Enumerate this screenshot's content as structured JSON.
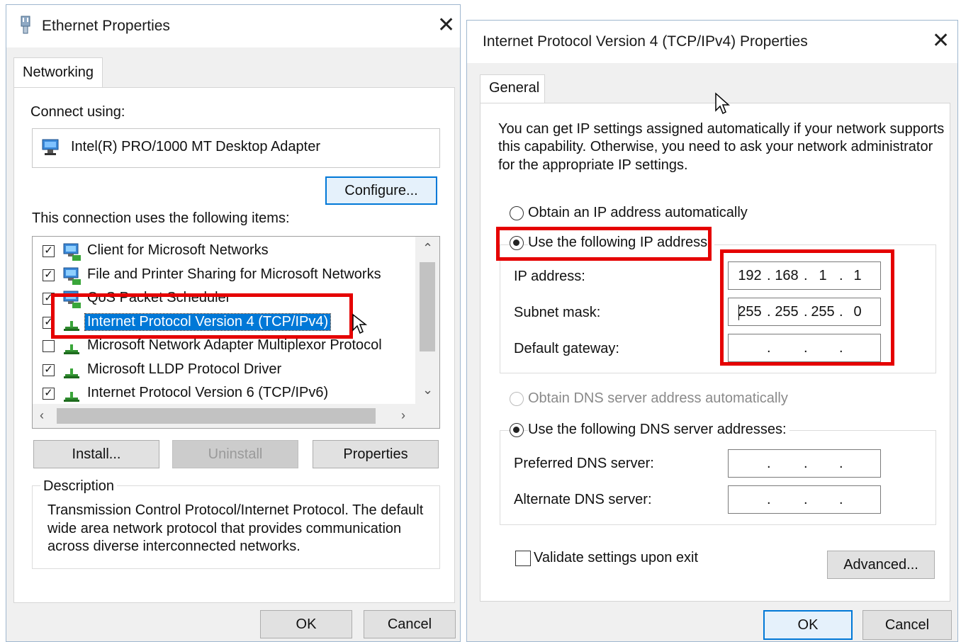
{
  "left": {
    "title": "Ethernet Properties",
    "tab": "Networking",
    "connect_using_label": "Connect using:",
    "adapter_name": "Intel(R) PRO/1000 MT Desktop Adapter",
    "configure_button": "Configure...",
    "items_label": "This connection uses the following items:",
    "items": [
      {
        "label": "Client for Microsoft Networks",
        "checked": true,
        "icon": "network-client-icon"
      },
      {
        "label": "File and Printer Sharing for Microsoft Networks",
        "checked": true,
        "icon": "file-sharing-icon"
      },
      {
        "label": "QoS Packet Scheduler",
        "checked": true,
        "icon": "qos-icon"
      },
      {
        "label": "Internet Protocol Version 4 (TCP/IPv4)",
        "checked": true,
        "selected": true,
        "icon": "protocol-icon"
      },
      {
        "label": "Microsoft Network Adapter Multiplexor Protocol",
        "checked": false,
        "icon": "protocol-icon"
      },
      {
        "label": "Microsoft LLDP Protocol Driver",
        "checked": true,
        "icon": "protocol-icon"
      },
      {
        "label": "Internet Protocol Version 6 (TCP/IPv6)",
        "checked": true,
        "icon": "protocol-icon"
      }
    ],
    "install_button": "Install...",
    "uninstall_button": "Uninstall",
    "properties_button": "Properties",
    "description_label": "Description",
    "description_lines": [
      "Transmission Control Protocol/Internet Protocol. The default",
      "wide area network protocol that provides communication",
      "across diverse interconnected networks."
    ],
    "ok_button": "OK",
    "cancel_button": "Cancel"
  },
  "right": {
    "title": "Internet Protocol Version 4 (TCP/IPv4) Properties",
    "tab": "General",
    "intro_lines": [
      "You can get IP settings assigned automatically if your network supports",
      "this capability. Otherwise, you need to ask your network administrator",
      "for the appropriate IP settings."
    ],
    "obtain_ip_auto": "Obtain an IP address automatically",
    "use_following_ip": "Use the following IP address:",
    "ip_address_label": "IP address:",
    "subnet_mask_label": "Subnet mask:",
    "default_gateway_label": "Default gateway:",
    "ip_address": [
      "192",
      "168",
      "1",
      "1"
    ],
    "subnet_mask": [
      "255",
      "255",
      "255",
      "0"
    ],
    "default_gateway": [
      "",
      "",
      "",
      ""
    ],
    "obtain_dns_auto": "Obtain DNS server address automatically",
    "use_following_dns": "Use the following DNS server addresses:",
    "preferred_dns_label": "Preferred DNS server:",
    "alternate_dns_label": "Alternate DNS server:",
    "preferred_dns": [
      "",
      "",
      "",
      ""
    ],
    "alternate_dns": [
      "",
      "",
      "",
      ""
    ],
    "validate_label": "Validate settings upon exit",
    "advanced_button": "Advanced...",
    "ok_button": "OK",
    "cancel_button": "Cancel"
  },
  "colors": {
    "highlight": "#0078d7",
    "annotation_red": "#e50000",
    "window_bg": "#f0f0f0"
  }
}
